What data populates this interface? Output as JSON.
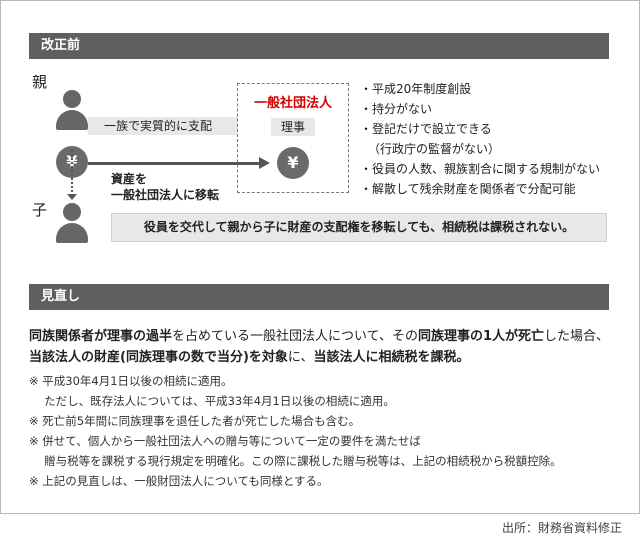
{
  "sections": {
    "before": "改正前",
    "after": "見直し"
  },
  "diagram": {
    "parent": "親",
    "child": "子",
    "control": "一族で実質的に支配",
    "transfer_line1": "資産を",
    "transfer_line2": "一般社団法人に移転",
    "corp_title": "一般社団法人",
    "director": "理事",
    "yen": "¥",
    "features": [
      "・平成20年制度創設",
      "・持分がない",
      "・登記だけで設立できる",
      "（行政庁の監督がない）",
      "・役員の人数、親族割合に関する規制がない",
      "・解散して残余財産を関係者で分配可能"
    ],
    "conclusion": "役員を交代して親から子に財産の支配権を移転しても、相続税は課税されない。"
  },
  "revision": {
    "p1_a": "同族関係者が理事の過半",
    "p1_b": "を占めている一般社団法人について、その",
    "p1_c": "同族理事の1人が死亡",
    "p1_d": "した場合、",
    "p2_a": "当該法人の財産(同族理事の数で当分)を対象",
    "p2_b": "に、",
    "p2_c": "当該法人に相続税を課税。",
    "notes": [
      "※ 平成30年4月1日以後の相続に適用。",
      "　 ただし、既存法人については、平成33年4月1日以後の相続に適用。",
      "※ 死亡前5年間に同族理事を退任した者が死亡した場合も含む。",
      "※ 併せて、個人から一般社団法人への贈与等について一定の要件を満たせば",
      "　 贈与税等を課税する現行規定を明確化。この際に課税した贈与税等は、上記の相続税から税額控除。",
      "※ 上記の見直しは、一般財団法人についても同様とする。"
    ]
  },
  "source": "出所：財務省資料修正"
}
